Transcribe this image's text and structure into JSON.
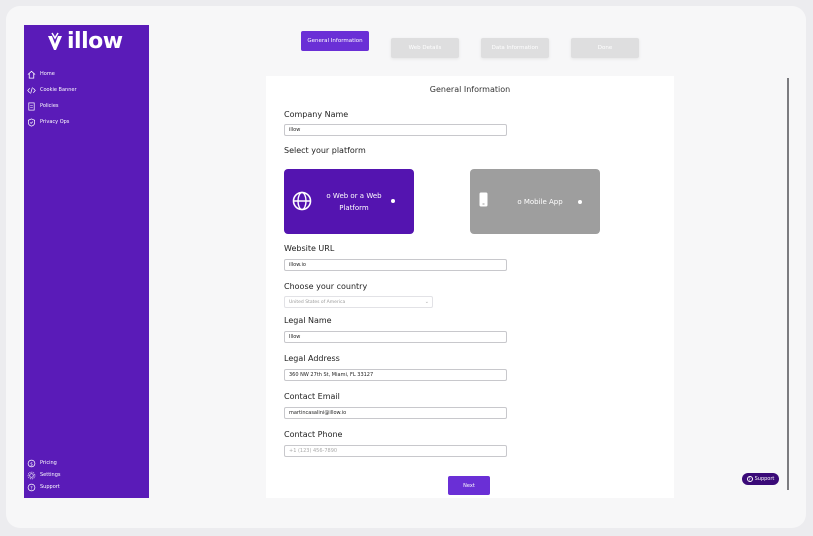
{
  "sidebar": {
    "logo_text": "illow",
    "items": [
      {
        "label": "Home",
        "icon": "home-icon"
      },
      {
        "label": "Cookie Banner",
        "icon": "code-icon"
      },
      {
        "label": "Policies",
        "icon": "document-icon"
      },
      {
        "label": "Privacy Ops",
        "icon": "shield-icon"
      }
    ],
    "bottom_items": [
      {
        "label": "Pricing",
        "icon": "dollar-icon"
      },
      {
        "label": "Settings",
        "icon": "gear-icon"
      },
      {
        "label": "Support",
        "icon": "help-icon"
      }
    ]
  },
  "steps": [
    {
      "label": "General Information",
      "active": true
    },
    {
      "label": "Web Details",
      "active": false
    },
    {
      "label": "Data Information",
      "active": false
    },
    {
      "label": "Done",
      "active": false
    }
  ],
  "form": {
    "title": "General Information",
    "company_name_label": "Company Name",
    "company_name_value": "illow",
    "platform_label": "Select your platform",
    "platform_web": "o Web or a Web Platform",
    "platform_mobile": "o Mobile App",
    "website_url_label": "Website URL",
    "website_url_value": "illow.io",
    "country_label": "Choose your country",
    "country_value": "United States of America",
    "legal_name_label": "Legal Name",
    "legal_name_value": "Illow",
    "legal_address_label": "Legal Address",
    "legal_address_value": "360 NW 27th St, Miami, FL 33127",
    "contact_email_label": "Contact Email",
    "contact_email_value": "martincasalini@illow.io",
    "contact_phone_label": "Contact Phone",
    "contact_phone_placeholder": "+1 (123) 456-7890",
    "next_label": "Next"
  },
  "support_label": "Support",
  "colors": {
    "brand": "#5a1bb8",
    "accent": "#6a2fd6",
    "mobile_card": "#9e9e9e"
  }
}
